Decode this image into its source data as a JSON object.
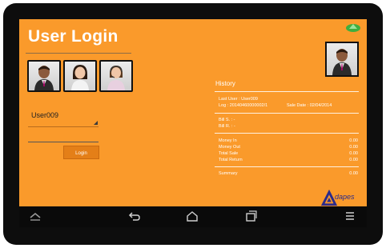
{
  "app": {
    "title": "User Login"
  },
  "users": [
    {
      "name": "male-avatar"
    },
    {
      "name": "female-avatar"
    },
    {
      "name": "headset-avatar"
    }
  ],
  "login": {
    "selected_user": "User009",
    "password_value": "",
    "button_label": "Login"
  },
  "history": {
    "title": "History",
    "last_user": "Last User : User009",
    "log": "Log : 20140460000002/1",
    "sale_date": "Sale Date : 02/04/2014",
    "bill_s": "Bill S. :  -",
    "bill_r": "Bill R. :  -",
    "rows": [
      {
        "label": "Money In",
        "value": "0.00"
      },
      {
        "label": "Money Out",
        "value": "0.00"
      },
      {
        "label": "Total Sale",
        "value": "0.00"
      },
      {
        "label": "Total Return",
        "value": "0.00"
      }
    ],
    "summary_label": "Summary",
    "summary_value": "0.00"
  },
  "brand": {
    "logo_text": "dapes"
  },
  "nav": {
    "icons": [
      "home-up-icon",
      "back-icon",
      "home-icon",
      "recent-apps-icon",
      "menu-icon"
    ]
  },
  "colors": {
    "accent": "#fa9a2b",
    "bezel": "#0d0d0d",
    "button": "#e47f18"
  }
}
